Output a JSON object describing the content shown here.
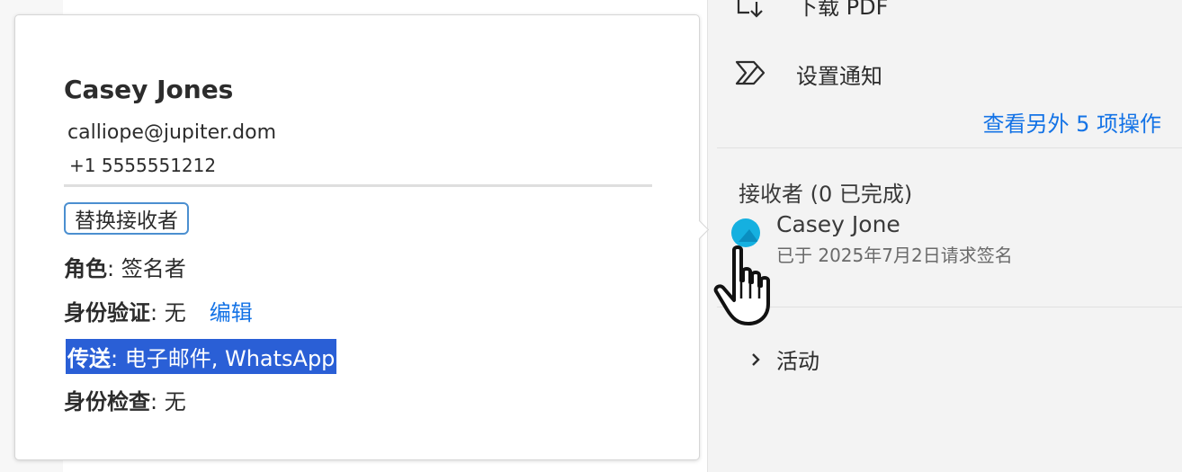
{
  "sidebar": {
    "download_label": "下载 PDF",
    "notify_label": "设置通知",
    "more_actions_link": "查看另外 5 项操作",
    "recipients_header": "接收者 (0 已完成)",
    "recipient": {
      "name": "Casey Jone",
      "status": "已于 2025年7月2日请求签名"
    },
    "activity_label": "活动"
  },
  "popover": {
    "name": "Casey Jones",
    "email": "calliope@jupiter.dom",
    "phone": "+1 5555551212",
    "replace_button": "替换接收者",
    "role_label": "角色",
    "role_value": ": 签名者",
    "auth_label": "身份验证",
    "auth_value": ": 无",
    "edit_link": "编辑",
    "delivery_label": "传送",
    "delivery_value": ": 电子邮件, WhatsApp",
    "idcheck_label": "身份检查",
    "idcheck_value": ": 无"
  },
  "colors": {
    "link": "#1473e6",
    "selection": "#2a5fd6",
    "avatar": "#15b0e0"
  }
}
